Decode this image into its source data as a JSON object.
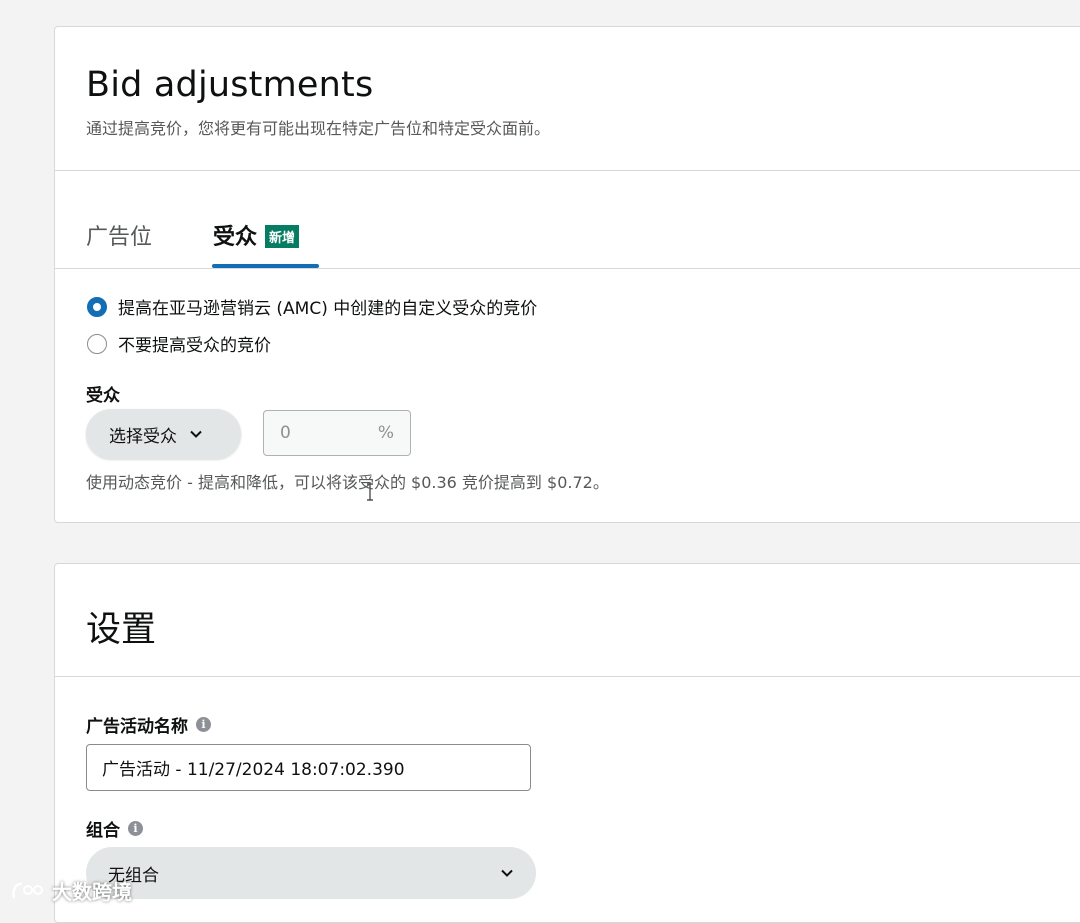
{
  "bid_adjustments": {
    "title": "Bid adjustments",
    "subtitle": "通过提高竞价，您将更有可能出现在特定广告位和特定受众面前。",
    "tabs": [
      {
        "label": "广告位",
        "active": false
      },
      {
        "label": "受众",
        "active": true,
        "badge": "新增"
      }
    ],
    "radios": [
      {
        "label": "提高在亚马逊营销云 (AMC) 中创建的自定义受众的竞价",
        "checked": true
      },
      {
        "label": "不要提高受众的竞价",
        "checked": false
      }
    ],
    "audience_label": "受众",
    "audience_select": "选择受众",
    "percent_value": "0",
    "percent_unit": "%",
    "hint": "使用动态竞价 - 提高和降低，可以将该受众的 $0.36 竞价提高到 $0.72。"
  },
  "settings": {
    "title": "设置",
    "campaign_name_label": "广告活动名称",
    "campaign_name_value": "广告活动 - 11/27/2024 18:07:02.390",
    "portfolio_label": "组合",
    "portfolio_value": "无组合"
  },
  "icons": {
    "info": "i"
  },
  "watermark": {
    "text": "大数跨境"
  },
  "colors": {
    "accent": "#146eb4",
    "badge": "#067d62"
  }
}
